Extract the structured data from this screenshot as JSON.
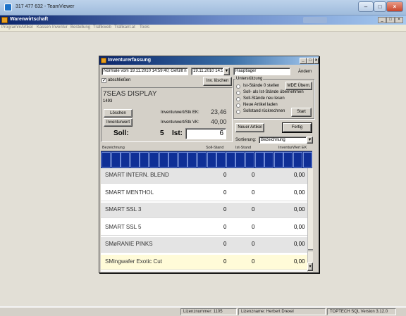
{
  "teamviewer": {
    "title": "317 477 632 - TeamViewer"
  },
  "app": {
    "title": "Warenwirtschaft",
    "menu": [
      "Programm",
      "Artikel",
      "Kassen",
      "Inventur",
      "Bestellung",
      "Trafikweb",
      "Trafikant.at",
      "Tools"
    ],
    "mdi_buttons": [
      "_",
      "□",
      "×"
    ]
  },
  "dialog": {
    "title": "Inventurerfassung",
    "inventory_name": "Normale vom 19.11.2010 14:59:40; Gefüllt n",
    "date": "19.11.2010 14:5",
    "location": "Hauptlager",
    "change_label": "Ändern",
    "complete_label": "abschließen",
    "complete_checked": true,
    "clear_inventory_label": "Inv. löschen",
    "article_name": "7SEAS DISPLAY",
    "article_number": "1493",
    "delete_label": "Löschen",
    "inventory_value_label": "Inventurwert",
    "ek_label": "Inventurwert/Stk EK:",
    "ek_value": "23,46",
    "vk_label": "Inventurwert/Stk VK:",
    "vk_value": "40,00",
    "soll_label": "Soll:",
    "soll_value": "5",
    "ist_label": "Ist:",
    "ist_value": "6",
    "support": {
      "title": "Unterstützung",
      "options": [
        "Ist-Stände 0 stellen",
        "Soll- als Ist-Stände übernehmen",
        "Soll-Stände neu lesen",
        "Neue Artikel laden",
        "Sollstand rückrechnen"
      ],
      "mde_button": "MDE Übern.",
      "start_button": "Start"
    },
    "new_article_label": "Neuer Artikel",
    "done_label": "Fertig",
    "sort_label": "Sortierung:",
    "sort_value": "Bezeichnung",
    "columns": [
      "Bezeichnung",
      "Soll-Stand",
      "Ist-Stand",
      "InventurWert EK"
    ],
    "rows": [
      {
        "name": "SMART INTERN. BLEND",
        "soll": "0",
        "ist": "0",
        "wert": "0,00"
      },
      {
        "name": "SMART MENTHOL",
        "soll": "0",
        "ist": "0",
        "wert": "0,00"
      },
      {
        "name": "SMART SSL 3",
        "soll": "0",
        "ist": "0",
        "wert": "0,00"
      },
      {
        "name": "SMART SSL 5",
        "soll": "0",
        "ist": "0",
        "wert": "0,00"
      },
      {
        "name": "SMøRANIE PINKS",
        "soll": "0",
        "ist": "0",
        "wert": "0,00"
      },
      {
        "name": "SMingwafer Exotic Cut",
        "soll": "0",
        "ist": "0",
        "wert": "0,00"
      }
    ]
  },
  "statusbar": {
    "license_number": "Lizenznummer: 1105",
    "license_name": "Lizenzname: Herbert Drexel",
    "version": "TOPTECH SQL Version 3.12.0"
  },
  "colors": {
    "title_blue": "#0a246a",
    "grid_blue": "#0f2f96",
    "highlight_row": "#fffbd8"
  }
}
